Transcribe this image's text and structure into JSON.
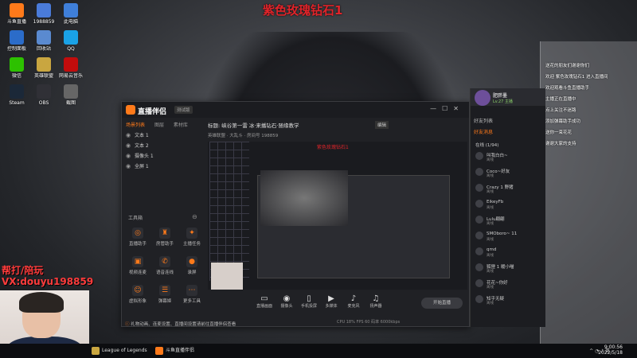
{
  "banner": "紫色玫瑰钻石1",
  "ad_line1": "帮打/陪玩",
  "ad_line2": "VX:douyu198859",
  "desktop_icons": [
    {
      "label": "斗鱼直播",
      "color": "#ff7a1a",
      "icon": "douyu-icon"
    },
    {
      "label": "1988859",
      "color": "#4a7bd9",
      "icon": "folder-icon"
    },
    {
      "label": "此电脑",
      "color": "#3f7fd9",
      "icon": "computer-icon"
    },
    {
      "label": "控制面板",
      "color": "#2b6cc9",
      "icon": "control-panel-icon"
    },
    {
      "label": "回收站",
      "color": "#5a8ad0",
      "icon": "recycle-icon"
    },
    {
      "label": "QQ",
      "color": "#1aa2e6",
      "icon": "qq-icon"
    },
    {
      "label": "微信",
      "color": "#2dc100",
      "icon": "wechat-icon"
    },
    {
      "label": "英雄联盟",
      "color": "#c9a640",
      "icon": "lol-icon"
    },
    {
      "label": "网易云音乐",
      "color": "#c20c0c",
      "icon": "music-icon"
    },
    {
      "label": "Steam",
      "color": "#1b2838",
      "icon": "steam-icon"
    },
    {
      "label": "OBS",
      "color": "#303036",
      "icon": "obs-icon"
    },
    {
      "label": "截图",
      "color": "#666",
      "icon": "screenshot-icon"
    }
  ],
  "right_chat": [
    "送花的朋友们谢谢你们",
    "欢迎 紫色玫瑰钻石1 进入直播间",
    "欢迎观看斗鱼直播助手",
    "主播正在直播中",
    "点上关注不迷路",
    "添加弹幕助手成功",
    "送你一束花花",
    "谢谢大家的支持"
  ],
  "app": {
    "name": "直播伴侣",
    "version": "测试版",
    "tabs": [
      "场景列表",
      "图层",
      "素材库"
    ],
    "scenes": [
      "文本 1",
      "文本 2",
      "摄像头 1",
      "全屏 1"
    ],
    "tools_title": "工具箱",
    "tools": [
      {
        "label": "直播助手",
        "icon": "assistant-icon",
        "glyph": "◎"
      },
      {
        "label": "房管助手",
        "icon": "moderator-icon",
        "glyph": "♜"
      },
      {
        "label": "主播任务",
        "icon": "task-icon",
        "glyph": "✦"
      },
      {
        "label": "视频连麦",
        "icon": "video-call-icon",
        "glyph": "▣"
      },
      {
        "label": "语音连线",
        "icon": "voice-icon",
        "glyph": "✆"
      },
      {
        "label": "录屏",
        "icon": "record-icon",
        "glyph": "●"
      },
      {
        "label": "虚拟形象",
        "icon": "avatar-icon",
        "glyph": "☺"
      },
      {
        "label": "弹幕姬",
        "icon": "danmaku-icon",
        "glyph": "☰"
      },
      {
        "label": "更多工具",
        "icon": "more-icon",
        "glyph": "⋯"
      }
    ],
    "notice": "礼物动画、连麦设置、直播间设置请前往直播伴侣查看",
    "stream_title": "标题: 峡谷第一雷 冰·来播钻石·随缘教学",
    "stream_sub": "英雄联盟 · 大乱斗 · 房间号 198859",
    "edit_label": "编辑",
    "controls": [
      {
        "label": "直播画面",
        "icon": "screen-icon",
        "glyph": "▭"
      },
      {
        "label": "摄像头",
        "icon": "camera-icon",
        "glyph": "◉"
      },
      {
        "label": "手机投屏",
        "icon": "phone-icon",
        "glyph": "▯"
      },
      {
        "label": "多媒体",
        "icon": "media-icon",
        "glyph": "▶"
      },
      {
        "label": "麦克风",
        "icon": "mic-icon",
        "glyph": "♪"
      },
      {
        "label": "扬声器",
        "icon": "speaker-icon",
        "glyph": "♫"
      }
    ],
    "start_button": "开始直播",
    "status": "CPU 18%  FPS 60  码率 6000kbps"
  },
  "chat_panel": {
    "user_name": "肥胖墨",
    "user_sub": "Lv.27 主播",
    "tab1": "好友列表",
    "tab2": "好友消息",
    "count": "在线 (1/94)",
    "viewers": [
      {
        "name": "叫我白白~",
        "sub": "离线"
      },
      {
        "name": "Coco~好友",
        "sub": "离线"
      },
      {
        "name": "Crazy 1 野猪",
        "sub": "离线"
      },
      {
        "name": "EikeyFb",
        "sub": "离线"
      },
      {
        "name": "Lulu翩翩",
        "sub": "离线"
      },
      {
        "name": "SMOboro~ 11",
        "sub": "离线"
      },
      {
        "name": "qmd",
        "sub": "离线"
      },
      {
        "name": "狐狸 1 暖小喵",
        "sub": "离线"
      },
      {
        "name": "花花~你好",
        "sub": "离线"
      },
      {
        "name": "知乎无疑",
        "sub": "离线"
      }
    ]
  },
  "taskbar": {
    "tasks": [
      {
        "label": "League of Legends",
        "color": "#c9a640",
        "icon": "lol-icon"
      },
      {
        "label": "斗鱼直播伴侣",
        "color": "#ff7a1a",
        "icon": "douyu-icon"
      }
    ],
    "time": "9:00:56",
    "date": "2022/5/18"
  }
}
